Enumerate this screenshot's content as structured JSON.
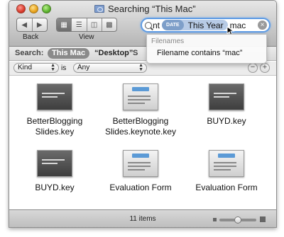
{
  "window": {
    "title": "Searching “This Mac”"
  },
  "toolbar": {
    "back_label": "Back",
    "view_label": "View",
    "view_active_index": 0
  },
  "search": {
    "typed_prefix": "nt",
    "token_category": "DATE",
    "token_value": "This Year",
    "typed_suffix": "mac"
  },
  "suggestions": {
    "header": "Filenames",
    "option": "Filename contains “mac”"
  },
  "scope": {
    "label": "Search:",
    "selected": "This Mac",
    "option": "“Desktop”",
    "option_partial": "S"
  },
  "criteria": {
    "attribute": "Kind",
    "operator": "is",
    "value": "Any"
  },
  "files": [
    {
      "line1": "BetterBlogging",
      "line2": "Slides.key",
      "thumb": "dark"
    },
    {
      "line1": "BetterBlogging",
      "line2": "Slides.keynote.key",
      "thumb": "light"
    },
    {
      "line1": "BUYD.key",
      "line2": "",
      "thumb": "dark"
    },
    {
      "line1": "BUYD.key",
      "line2": "",
      "thumb": "dark"
    },
    {
      "line1": "Evaluation Form",
      "line2": "",
      "thumb": "light"
    },
    {
      "line1": "Evaluation Form",
      "line2": "",
      "thumb": "light"
    }
  ],
  "status": {
    "item_count": "11 items",
    "icon_size_level": 0.5
  },
  "colors": {
    "search_focus": "#5e9be3",
    "token_bg": "#b7cbe6",
    "scope_selected_bg": "#8a8a8a"
  }
}
